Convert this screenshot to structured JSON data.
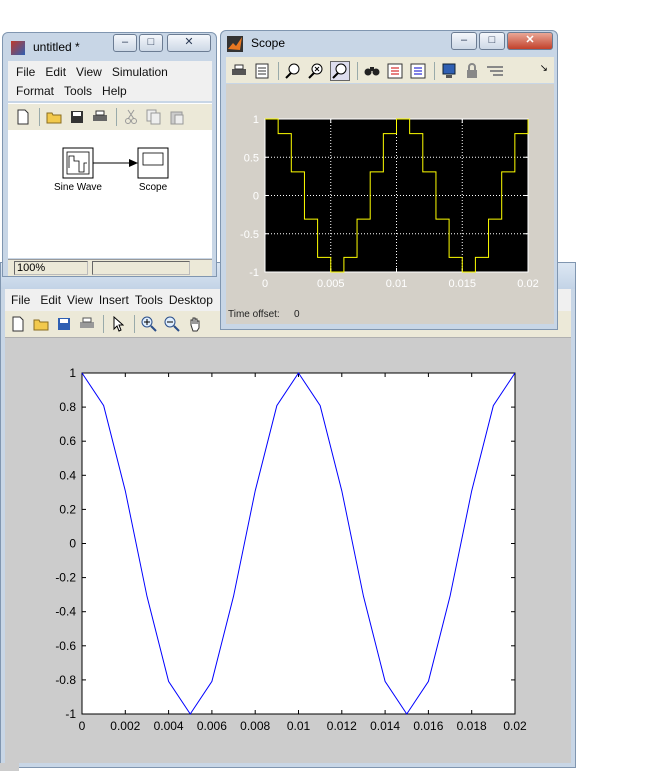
{
  "simulink": {
    "title": "untitled *",
    "menu": [
      "File",
      "Edit",
      "View",
      "Simulation",
      "Format",
      "Tools",
      "Help"
    ],
    "blocks": {
      "sine_wave": "Sine Wave",
      "scope": "Scope"
    },
    "status": {
      "zoom": "100%"
    }
  },
  "scope": {
    "title": "Scope",
    "time_offset_label": "Time offset:",
    "time_offset_value": "0"
  },
  "figure": {
    "menu": [
      "File",
      "Edit",
      "View",
      "Insert",
      "Tools",
      "Desktop"
    ]
  },
  "colors": {
    "scope_bg": "#000000",
    "scope_trace": "#ffff00",
    "plot_line": "#0000ff",
    "figure_bg": "#cccccc",
    "window_frame": "#c8d6e6"
  },
  "chart_data": [
    {
      "type": "line",
      "name": "scope-plot",
      "x": [
        0,
        0.001,
        0.002,
        0.003,
        0.004,
        0.005,
        0.006,
        0.007,
        0.008,
        0.009,
        0.01,
        0.011,
        0.012,
        0.013,
        0.014,
        0.015,
        0.016,
        0.017,
        0.018,
        0.019,
        0.02
      ],
      "y": [
        1,
        0.809,
        0.309,
        -0.309,
        -0.809,
        -1,
        -0.809,
        -0.309,
        0.309,
        0.809,
        1,
        0.809,
        0.309,
        -0.309,
        -0.809,
        -1,
        -0.809,
        -0.309,
        0.309,
        0.809,
        1
      ],
      "step": true,
      "xlim": [
        0,
        0.02
      ],
      "ylim": [
        -1,
        1
      ],
      "xticks": [
        "0",
        "0.005",
        "0.01",
        "0.015",
        "0.02"
      ],
      "yticks": [
        "1",
        "0.5",
        "0",
        "-0.5",
        "-1"
      ],
      "grid": true
    },
    {
      "type": "line",
      "name": "figure-plot",
      "x": [
        0,
        0.001,
        0.002,
        0.003,
        0.004,
        0.005,
        0.006,
        0.007,
        0.008,
        0.009,
        0.01,
        0.011,
        0.012,
        0.013,
        0.014,
        0.015,
        0.016,
        0.017,
        0.018,
        0.019,
        0.02
      ],
      "y": [
        1,
        0.809,
        0.309,
        -0.309,
        -0.809,
        -1,
        -0.809,
        -0.309,
        0.309,
        0.809,
        1,
        0.809,
        0.309,
        -0.309,
        -0.809,
        -1,
        -0.809,
        -0.309,
        0.309,
        0.809,
        1
      ],
      "xlim": [
        0,
        0.02
      ],
      "ylim": [
        -1,
        1
      ],
      "xticks": [
        "0",
        "0.002",
        "0.004",
        "0.006",
        "0.008",
        "0.01",
        "0.012",
        "0.014",
        "0.016",
        "0.018",
        "0.02"
      ],
      "yticks": [
        "1",
        "0.8",
        "0.6",
        "0.4",
        "0.2",
        "0",
        "-0.2",
        "-0.4",
        "-0.6",
        "-0.8",
        "-1"
      ],
      "grid": false
    }
  ]
}
